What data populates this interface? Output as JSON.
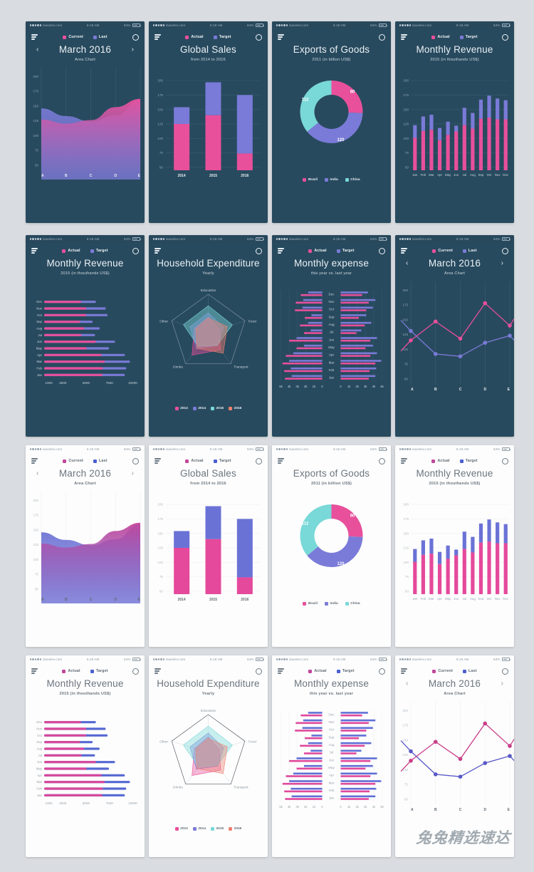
{
  "page": {
    "background": "#d9dde1",
    "watermark": "兔兔精选速达"
  },
  "theme": {
    "dark_bg": "#284A5E",
    "light_bg": "#FDFDFD",
    "pink": "#E8509B",
    "purple": "#7A7BD8",
    "pink_light": "#D9459A",
    "purple_light": "#5B6BD6",
    "teal": "#79D8D8"
  },
  "status_bar": {
    "carrier": "isavelev.com",
    "time": "6:18 AM",
    "battery": "64%"
  },
  "legends": {
    "current_last": [
      {
        "label": "Current",
        "color": "#E8509B"
      },
      {
        "label": "Last",
        "color": "#7A7BD8"
      }
    ],
    "current_last_light": [
      {
        "label": "Current",
        "color": "#C0479B"
      },
      {
        "label": "Last",
        "color": "#4A5FD0"
      }
    ],
    "actual_target": [
      {
        "label": "Actual",
        "color": "#E8509B"
      },
      {
        "label": "Target",
        "color": "#7A7BD8"
      }
    ],
    "actual_target_light": [
      {
        "label": "Actual",
        "color": "#C0479B"
      },
      {
        "label": "Target",
        "color": "#4A5FD0"
      }
    ]
  },
  "icons": {
    "menu": "hamburger-icon",
    "settings": "gear-icon",
    "prev": "‹",
    "next": "›"
  },
  "screens": [
    {
      "id": "area-dark",
      "theme": "dark",
      "type": "area",
      "title": "March 2016",
      "subtitle": "Area Chart",
      "legend": "current_last",
      "nav": true
    },
    {
      "id": "bars-dark",
      "theme": "dark",
      "type": "stacked-column",
      "title": "Global Sales",
      "subtitle": "from 2014 to 2016",
      "legend": "actual_target",
      "nav": false
    },
    {
      "id": "donut-dark",
      "theme": "dark",
      "type": "donut",
      "title": "Exports of Goods",
      "subtitle": "2011 (in billion US$)",
      "legend": "none",
      "nav": false
    },
    {
      "id": "columns-dark",
      "theme": "dark",
      "type": "monthly-column",
      "title": "Monthly Revenue",
      "subtitle": "2015 (in thouthands US$)",
      "legend": "actual_target",
      "nav": false
    },
    {
      "id": "hbar-dark",
      "theme": "dark",
      "type": "hbar",
      "title": "Monthly Revenue",
      "subtitle": "2015 (in thouthands US$)",
      "legend": "actual_target",
      "nav": false
    },
    {
      "id": "radar-dark",
      "theme": "dark",
      "type": "radar",
      "title": "Household Expenditure",
      "subtitle": "Yearly",
      "legend": "none",
      "nav": false
    },
    {
      "id": "tornado-dark",
      "theme": "dark",
      "type": "tornado",
      "title": "Monthly expense",
      "subtitle": "this year vs. last year",
      "legend": "actual_target",
      "nav": false
    },
    {
      "id": "line-dark",
      "theme": "dark",
      "type": "line",
      "title": "March 2016",
      "subtitle": "Area Chart",
      "legend": "current_last",
      "nav": true
    },
    {
      "id": "area-light",
      "theme": "light",
      "type": "area",
      "title": "March 2016",
      "subtitle": "Area Chart",
      "legend": "current_last_light",
      "nav": true
    },
    {
      "id": "bars-light",
      "theme": "light",
      "type": "stacked-column",
      "title": "Global Sales",
      "subtitle": "from 2014 to 2016",
      "legend": "actual_target_light",
      "nav": false
    },
    {
      "id": "donut-light",
      "theme": "light",
      "type": "donut",
      "title": "Exports of Goods",
      "subtitle": "2011 (in billion US$)",
      "legend": "none",
      "nav": false
    },
    {
      "id": "columns-light",
      "theme": "light",
      "type": "monthly-column",
      "title": "Monthly Revenue",
      "subtitle": "2015 (in thouthands US$)",
      "legend": "actual_target_light",
      "nav": false
    },
    {
      "id": "hbar-light",
      "theme": "light",
      "type": "hbar",
      "title": "Monthly Revenue",
      "subtitle": "2015 (in thouthands US$)",
      "legend": "actual_target_light",
      "nav": false
    },
    {
      "id": "radar-light",
      "theme": "light",
      "type": "radar",
      "title": "Household Expenditure",
      "subtitle": "Yearly",
      "legend": "none",
      "nav": false
    },
    {
      "id": "tornado-light",
      "theme": "light",
      "type": "tornado",
      "title": "Monthly expense",
      "subtitle": "this year vs. last year",
      "legend": "actual_target_light",
      "nav": false
    },
    {
      "id": "line-light",
      "theme": "light",
      "type": "line",
      "title": "March 2016",
      "subtitle": "Area Chart",
      "legend": "current_last_light",
      "nav": true
    }
  ],
  "chart_data": [
    {
      "id": "area",
      "type": "area",
      "title": "March 2016",
      "subtitle": "Area Chart",
      "xlabel": "",
      "ylabel": "",
      "categories": [
        "A",
        "B",
        "C",
        "D",
        "E"
      ],
      "yticks": [
        50,
        75,
        100,
        125,
        150,
        175,
        200
      ],
      "ylim": [
        40,
        210
      ],
      "series": [
        {
          "name": "Current",
          "color": "#E8509B",
          "values": [
            127,
            120,
            126,
            148,
            162
          ]
        },
        {
          "name": "Last",
          "color": "#7A7BD8",
          "values": [
            146,
            133,
            124,
            134,
            160
          ]
        }
      ],
      "legend_position": "top"
    },
    {
      "id": "stacked-column",
      "type": "bar",
      "title": "Global Sales",
      "subtitle": "from 2014 to 2016",
      "categories": [
        "2014",
        "2015",
        "2016"
      ],
      "yticks": [
        50,
        75,
        100,
        125,
        150,
        175,
        200
      ],
      "ylim": [
        45,
        205
      ],
      "series": [
        {
          "name": "Actual",
          "color": "#E8509B",
          "values": [
            125,
            140,
            74
          ]
        },
        {
          "name": "Target",
          "color": "#7A7BD8",
          "values": [
            154,
            197,
            175
          ]
        }
      ],
      "legend_position": "top"
    },
    {
      "id": "donut",
      "type": "pie",
      "title": "Exports of Goods",
      "subtitle": "2011 (in billion US$)",
      "labels": [
        "Brazil",
        "India",
        "China"
      ],
      "values": [
        80,
        120,
        112
      ],
      "colors": [
        "#E8509B",
        "#7A7BD8",
        "#79D8D8"
      ],
      "legend_position": "bottom"
    },
    {
      "id": "monthly-column",
      "type": "bar",
      "title": "Monthly Revenue",
      "subtitle": "2015 (in thouthands US$)",
      "categories": [
        "Jan",
        "Feb",
        "Mar",
        "Apr",
        "May",
        "Jun",
        "Jul",
        "Aug",
        "Sep",
        "Oct",
        "Nov",
        "Dec"
      ],
      "yticks": [
        50,
        75,
        100,
        125,
        150,
        175,
        200
      ],
      "ylim": [
        45,
        205
      ],
      "series": [
        {
          "name": "Actual",
          "color": "#E8509B",
          "values": [
            101,
            113,
            115,
            97,
            106,
            112,
            123,
            117,
            134,
            136,
            133,
            133
          ]
        },
        {
          "name": "Target",
          "color": "#7A7BD8",
          "values": [
            123,
            138,
            141,
            118,
            129,
            122,
            153,
            144,
            167,
            174,
            169,
            166
          ]
        }
      ],
      "legend_position": "top"
    },
    {
      "id": "hbar",
      "type": "bar",
      "title": "Monthly Revenue",
      "subtitle": "2015 (in thouthands US$)",
      "orientation": "horizontal",
      "categories": [
        "Dec",
        "Nov",
        "Oct",
        "Sep",
        "Aug",
        "Jul",
        "Jun",
        "May",
        "Apr",
        "Mar",
        "Feb",
        "Jan"
      ],
      "xticks": [
        1000,
        2500,
        5000,
        7500,
        10000
      ],
      "xlim": [
        500,
        10500
      ],
      "series": [
        {
          "name": "Actual",
          "color": "#E8509B",
          "values": [
            4450,
            5000,
            5000,
            4350,
            4800,
            4500,
            6050,
            5050,
            6650,
            7000,
            6800,
            6750
          ]
        },
        {
          "name": "Target",
          "color": "#7A7BD8",
          "values": [
            6050,
            7100,
            7300,
            5700,
            6450,
            5950,
            8100,
            7450,
            9150,
            9700,
            9300,
            9150
          ]
        }
      ],
      "legend_position": "top"
    },
    {
      "id": "radar",
      "type": "radar",
      "title": "Household Expenditure",
      "subtitle": "Yearly",
      "axes": [
        "Education",
        "Food",
        "Transport",
        "Drinks",
        "Other"
      ],
      "series": [
        {
          "name": "2013",
          "color": "#E8509B",
          "values": [
            0.42,
            0.3,
            0.55,
            0.72,
            0.38
          ]
        },
        {
          "name": "2014",
          "color": "#7A7BD8",
          "values": [
            0.52,
            0.42,
            0.42,
            0.52,
            0.5
          ]
        },
        {
          "name": "2015",
          "color": "#79D8D8",
          "values": [
            0.7,
            0.66,
            0.4,
            0.44,
            0.68
          ]
        },
        {
          "name": "2016",
          "color": "#EE8070",
          "values": [
            0.38,
            0.52,
            0.66,
            0.5,
            0.34
          ]
        }
      ],
      "legend_position": "bottom"
    },
    {
      "id": "tornado",
      "type": "bar",
      "title": "Monthly expense",
      "subtitle": "this year vs. last year",
      "orientation": "bidirectional",
      "categories": [
        "Dec",
        "Nov",
        "Oct",
        "Sep",
        "Aug",
        "Jul",
        "Jun",
        "May",
        "Apr",
        "Mar",
        "Feb",
        "Jan"
      ],
      "xticks_left": [
        "5k",
        "4k",
        "3k",
        "2k",
        "1k",
        "0"
      ],
      "xticks_right": [
        "0",
        "1k",
        "2k",
        "3k",
        "4k",
        "5k"
      ],
      "series": [
        {
          "name": "Actual",
          "color": "#E8509B",
          "left_values": [
            2.6,
            3.2,
            3.3,
            2.1,
            2.7,
            2.2,
            4.0,
            3.1,
            4.4,
            4.8,
            4.6,
            4.5
          ],
          "right_values": [
            2.6,
            3.4,
            3.1,
            2.2,
            2.9,
            1.9,
            3.6,
            3.0,
            3.6,
            4.2,
            3.5,
            3.4
          ]
        },
        {
          "name": "Target",
          "color": "#7A7BD8",
          "left_values": [
            1.7,
            2.3,
            2.4,
            1.3,
            1.7,
            1.4,
            3.1,
            2.2,
            3.5,
            4.0,
            3.8,
            3.7
          ],
          "right_values": [
            3.3,
            4.2,
            3.9,
            3.1,
            3.7,
            2.5,
            4.4,
            3.9,
            4.4,
            4.9,
            4.3,
            4.2
          ]
        }
      ],
      "legend_position": "top"
    },
    {
      "id": "line",
      "type": "line",
      "title": "March 2016",
      "subtitle": "Area Chart",
      "categories": [
        "A",
        "B",
        "C",
        "D",
        "E"
      ],
      "yticks": [
        50,
        75,
        100,
        125,
        150,
        175,
        200
      ],
      "ylim": [
        40,
        210
      ],
      "series": [
        {
          "name": "Current",
          "color": "#E8509B",
          "values": [
            115,
            147,
            118,
            178,
            140
          ]
        },
        {
          "name": "Last",
          "color": "#7A7BD8",
          "values": [
            131,
            92,
            88,
            111,
            123
          ]
        }
      ],
      "legend_position": "top"
    }
  ]
}
